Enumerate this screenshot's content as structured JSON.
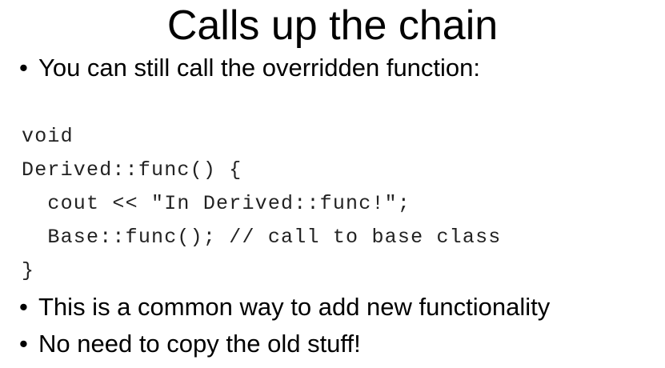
{
  "slide": {
    "title": "Calls up the chain",
    "bullet_symbol": "•",
    "bullets": [
      "You can still call the overridden function:",
      "This is a common way to add new functionality",
      "No need to copy the old stuff!"
    ],
    "code_lines": [
      "void",
      "Derived::func() {",
      "  cout << \"In Derived::func!\";",
      "  Base::func(); // call to base class",
      "}"
    ]
  }
}
